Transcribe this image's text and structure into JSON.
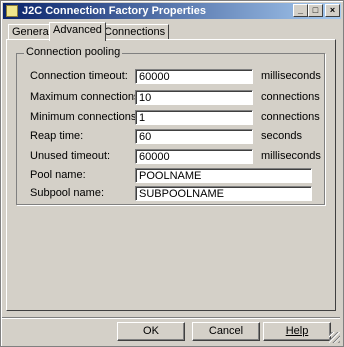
{
  "window": {
    "title": "J2C Connection Factory Properties",
    "controls": {
      "minimize": "_",
      "maximize": "□",
      "close": "×"
    }
  },
  "tabs": [
    {
      "label": "General",
      "active": false
    },
    {
      "label": "Advanced",
      "active": true
    },
    {
      "label": "Connections",
      "active": false
    }
  ],
  "group": {
    "title": "Connection pooling"
  },
  "fields": {
    "connection_timeout": {
      "label": "Connection timeout:",
      "value": "60000",
      "unit": "milliseconds"
    },
    "max_connections": {
      "label": "Maximum connections:",
      "value": "10",
      "unit": "connections"
    },
    "min_connections": {
      "label": "Minimum connections:",
      "value": "1",
      "unit": "connections"
    },
    "reap_time": {
      "label": "Reap time:",
      "value": "60",
      "unit": "seconds"
    },
    "unused_timeout": {
      "label": "Unused timeout:",
      "value": "60000",
      "unit": "milliseconds"
    },
    "pool_name": {
      "label": "Pool name:",
      "value": "POOLNAME"
    },
    "subpool_name": {
      "label": "Subpool name:",
      "value": "SUBPOOLNAME"
    }
  },
  "buttons": {
    "ok": "OK",
    "cancel": "Cancel",
    "help": "Help"
  }
}
